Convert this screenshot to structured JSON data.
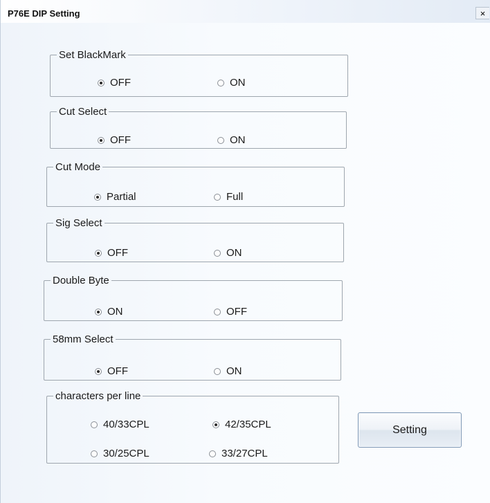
{
  "window": {
    "title": "P76E DIP Setting",
    "close_label": "×"
  },
  "groups": [
    {
      "id": "blackmark",
      "label": "Set BlackMark",
      "options": [
        {
          "label": "OFF",
          "checked": true
        },
        {
          "label": "ON",
          "checked": false
        }
      ]
    },
    {
      "id": "cutselect",
      "label": "Cut Select",
      "options": [
        {
          "label": "OFF",
          "checked": true
        },
        {
          "label": "ON",
          "checked": false
        }
      ]
    },
    {
      "id": "cutmode",
      "label": "Cut Mode",
      "options": [
        {
          "label": "Partial",
          "checked": true
        },
        {
          "label": "Full",
          "checked": false
        }
      ]
    },
    {
      "id": "sigselect",
      "label": "Sig Select",
      "options": [
        {
          "label": "OFF",
          "checked": true
        },
        {
          "label": "ON",
          "checked": false
        }
      ]
    },
    {
      "id": "doublebyte",
      "label": "Double Byte",
      "options": [
        {
          "label": "ON",
          "checked": true
        },
        {
          "label": "OFF",
          "checked": false
        }
      ]
    },
    {
      "id": "select58mm",
      "label": "58mm Select",
      "options": [
        {
          "label": "OFF",
          "checked": true
        },
        {
          "label": "ON",
          "checked": false
        }
      ]
    },
    {
      "id": "cpl",
      "label": "characters per line",
      "options": [
        {
          "label": "40/33CPL",
          "checked": false
        },
        {
          "label": "42/35CPL",
          "checked": true
        },
        {
          "label": "30/25CPL",
          "checked": false
        },
        {
          "label": "33/27CPL",
          "checked": false
        }
      ]
    }
  ],
  "setting_button": {
    "label": "Setting"
  }
}
